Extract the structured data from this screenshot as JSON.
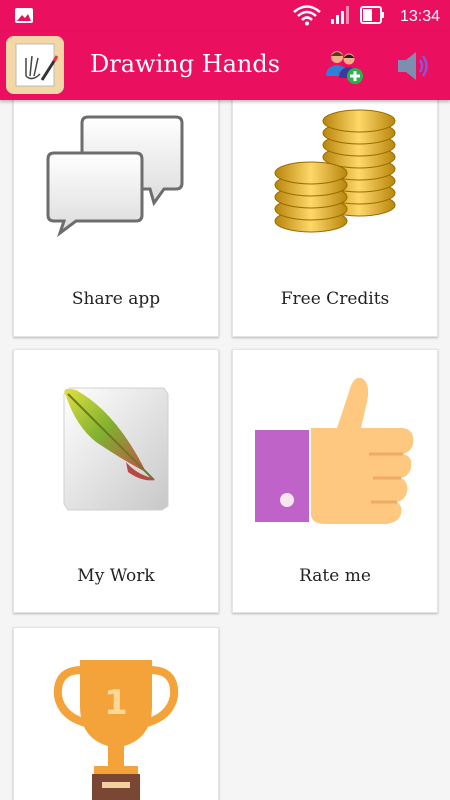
{
  "status_bar": {
    "time": "13:34",
    "icons": [
      "image-notification-icon",
      "wifi-icon",
      "signal-icon",
      "battery-icon"
    ]
  },
  "app_bar": {
    "title": "Drawing Hands",
    "actions": [
      "share-users-icon",
      "sound-icon"
    ]
  },
  "cards": [
    {
      "label": "Share app",
      "icon": "chat-bubbles-icon"
    },
    {
      "label": "Free Credits",
      "icon": "gold-coins-icon"
    },
    {
      "label": "My Work",
      "icon": "feather-icon"
    },
    {
      "label": "Rate me",
      "icon": "thumbs-up-icon"
    },
    {
      "label": "",
      "icon": "trophy-icon"
    }
  ],
  "colors": {
    "primary": "#ea0f5f",
    "background": "#f5f5f5",
    "card": "#ffffff"
  }
}
